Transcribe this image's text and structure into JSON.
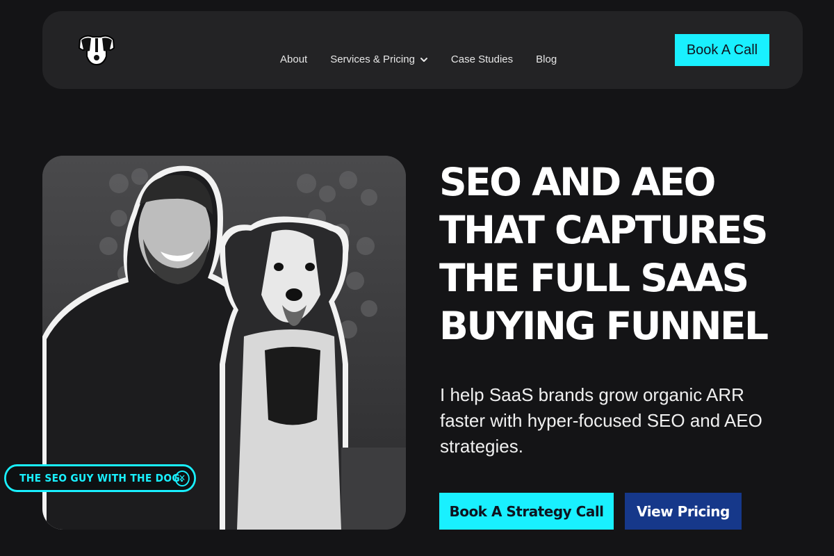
{
  "nav": {
    "logo_icon": "dog-head-icon",
    "links": [
      "About",
      "Services & Pricing",
      "Case Studies",
      "Blog"
    ],
    "dropdown_icon": "chevron-down-icon",
    "cta_label": "Book A Call"
  },
  "hero": {
    "headline_lines": [
      "SEO AND AEO",
      "THAT CAPTURES",
      "THE FULL SAAS",
      "BUYING FUNNEL"
    ],
    "subtext": "I help SaaS brands grow organic ARR faster with hyper-focused SEO and AEO strategies.",
    "primary_cta": "Book A Strategy Call",
    "secondary_cta": "View Pricing",
    "photo_label": "THE SEO GUY WITH  THE DOG.",
    "photo_close_icon": "close-circle-icon"
  },
  "colors": {
    "background": "#141416",
    "nav_bg": "#232325",
    "accent_cyan": "#19f0ff",
    "accent_navy": "#16388a"
  }
}
